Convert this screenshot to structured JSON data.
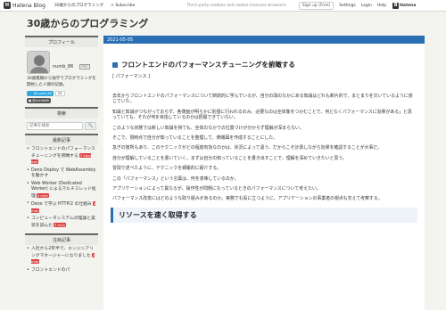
{
  "topbar": {
    "logo_text": "Hatena Blog",
    "blog_link": "30歳からのプログラミング",
    "subscribe": "+ Subscribe",
    "note": "Third party cookies and cookie insecure browsers",
    "signup": "Sign up (Free)",
    "links": [
      "Settings",
      "Login",
      "Help"
    ],
    "brand": "Hatena"
  },
  "blog": {
    "title": "30歳からのプログラミング"
  },
  "sidebar": {
    "profile_heading": "プロフィール",
    "username": "numb_86",
    "badge": "PRO",
    "desc": "30歳無職から独学でプログラミングを開始した人間の記録。",
    "twitter_label": "@numb_86",
    "twitter_count": "55",
    "github_label": "@numb86",
    "search_heading": "検索",
    "search_placeholder": "記事を検索",
    "search_button": "🔍",
    "recent_heading": "最新記事",
    "recent": [
      {
        "title": "フロントエンドのパフォーマンスチューニングを俯瞰する",
        "date": "3 days ago"
      },
      {
        "title": "Deno Deploy で WebAssembly を動かす",
        "date": ""
      },
      {
        "title": "Web Worker (Dedicated Worker) によるマルチスレッド処理",
        "date": "4 mon"
      },
      {
        "title": "Deno で学ぶ HTTP/2 の仕組み",
        "date": "4 mon"
      },
      {
        "title": "コンピュータシステムの理論と実装を読んだ",
        "date": "5 mon"
      }
    ],
    "popular_heading": "注目記事",
    "popular": [
      {
        "title": "入社から2年半で、エンジニアリングマネージャーになりました",
        "date": "2 mon"
      },
      {
        "title": "フロントエンドのパ",
        "date": ""
      }
    ]
  },
  "entry": {
    "date": "2021-05-05",
    "title": "フロントエンドのパフォーマンスチューニングを俯瞰する",
    "category": "[ パフォーマンス ]",
    "paragraphs": [
      "去年からフロントエンドのパフォーマンスについて断続的に学んでいるが、自分の頭のなかにある知識はどれも断片的で、まとまりを欠いているように感じていた。",
      "知識と知識がつながっておらず、各側面が明らかに別個に行われるのみ。必要なのは全体像をつかむことで、何となくパフォーマンスに効果がある」と思っていても、それが何を目指しているのかは把握できていない。",
      "このような状態では新しい知識を得ても、全体のなかでの位置づけが分からず理解が深まらない。",
      "そこで、現時点で自分が知っていることを整理して、俯瞰図を作成することにした。",
      "急ぎの箇所もあり、このテクニックがどの程度有効なのかは、状況によって違う。だからこそ計測しながら効果を確認することが大事だ。",
      "自分が理解していることを書いていく。まずは自分の知っていることを書き出すことで、理解を深めていきたいと思う。",
      "冒頭で述べたように、テクニックを網羅的に紹介する。",
      "この「パフォーマンス」という言葉は、何を意味しているのか。",
      "アプリケーションによって異なるが、操作性が問題になっているときのパフォーマンスについて考えたい。",
      "パフォーマンス改善にはどのような取り組みがあるのか。実務でも役に立つように、アプリケーションの事業者の視点も交えて考察する。"
    ],
    "section_heading": "リソースを速く取得する"
  }
}
